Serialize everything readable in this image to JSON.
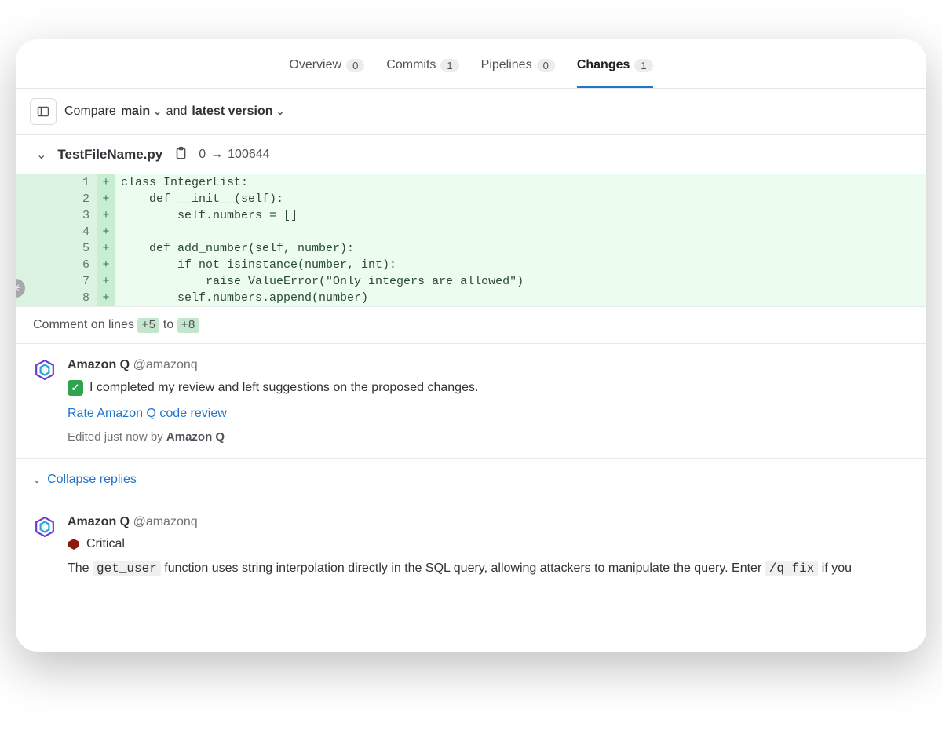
{
  "tabs": [
    {
      "label": "Overview",
      "count": "0",
      "active": false
    },
    {
      "label": "Commits",
      "count": "1",
      "active": false
    },
    {
      "label": "Pipelines",
      "count": "0",
      "active": false
    },
    {
      "label": "Changes",
      "count": "1",
      "active": true
    }
  ],
  "compare": {
    "label": "Compare",
    "branch": "main",
    "and": "and",
    "version": "latest version"
  },
  "file": {
    "name": "TestFileName.py",
    "mode_from": "0",
    "arrow": "→",
    "mode_to": "100644"
  },
  "diff": [
    {
      "n": "1",
      "code": "class IntegerList:"
    },
    {
      "n": "2",
      "code": "    def __init__(self):"
    },
    {
      "n": "3",
      "code": "        self.numbers = []"
    },
    {
      "n": "4",
      "code": ""
    },
    {
      "n": "5",
      "code": "    def add_number(self, number):"
    },
    {
      "n": "6",
      "code": "        if not isinstance(number, int):"
    },
    {
      "n": "7",
      "code": "            raise ValueError(\"Only integers are allowed\")"
    },
    {
      "n": "8",
      "code": "        self.numbers.append(number)"
    }
  ],
  "comment_range": {
    "prefix": "Comment on lines",
    "from": "+5",
    "to_word": "to",
    "to": "+8"
  },
  "review": {
    "author": "Amazon Q",
    "handle": "@amazonq",
    "message": "I completed my review and left suggestions on the proposed changes.",
    "rate_link": "Rate Amazon Q code review",
    "edited_prefix": "Edited just now by",
    "edited_by": "Amazon Q"
  },
  "collapse_label": "Collapse replies",
  "issue": {
    "author": "Amazon Q",
    "handle": "@amazonq",
    "severity": "Critical",
    "text_before": "The ",
    "code1": "get_user",
    "text_mid": " function uses string interpolation directly in the SQL query, allowing attackers to manipulate the query. Enter ",
    "code2": "/q fix",
    "text_after": " if you"
  }
}
